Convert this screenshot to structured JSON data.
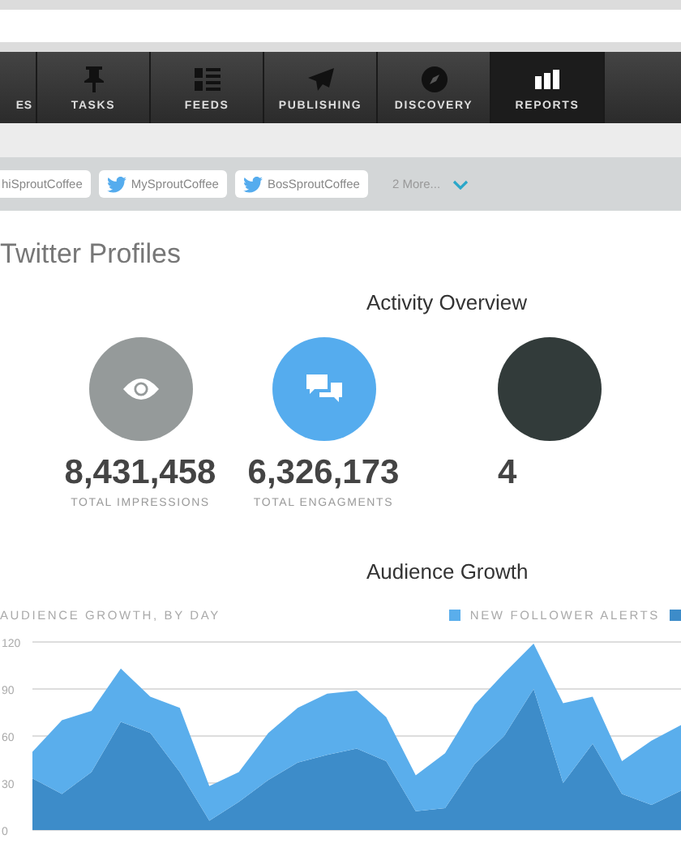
{
  "nav": {
    "tabs": [
      {
        "label": "ES",
        "selected": false
      },
      {
        "label": "TASKS",
        "selected": false
      },
      {
        "label": "FEEDS",
        "selected": false
      },
      {
        "label": "PUBLISHING",
        "selected": false
      },
      {
        "label": "DISCOVERY",
        "selected": false
      },
      {
        "label": "REPORTS",
        "selected": true
      }
    ]
  },
  "profiles": {
    "chips": [
      {
        "label": "hiSproutCoffee",
        "icon": false
      },
      {
        "label": "MySproutCoffee",
        "icon": true
      },
      {
        "label": "BosSproutCoffee",
        "icon": true
      }
    ],
    "more": "2 More..."
  },
  "page_title": "Twitter Profiles",
  "activity": {
    "title": "Activity Overview",
    "stats": [
      {
        "kind": "impressions",
        "color": "#959a9a",
        "value": "8,431,458",
        "label": "TOTAL IMPRESSIONS"
      },
      {
        "kind": "engagements",
        "color": "#55acee",
        "value": "6,326,173",
        "label": "TOTAL ENGAGMENTS"
      },
      {
        "kind": "partial",
        "color": "#323b3a",
        "value": "4"
      }
    ]
  },
  "audience": {
    "title": "Audience Growth",
    "chart_data": {
      "type": "area",
      "title": "AUDIENCE GROWTH, BY DAY",
      "stacked": true,
      "grid": true,
      "ylim": [
        0,
        120
      ],
      "yticks": [
        0,
        30,
        60,
        90,
        120
      ],
      "series": [
        {
          "color": "#3d8cc9",
          "values": [
            33,
            23,
            37,
            69,
            62,
            37,
            6,
            18,
            32,
            43,
            48,
            52,
            44,
            12,
            14,
            42,
            60,
            90,
            30,
            55,
            23,
            16,
            25
          ]
        },
        {
          "name": "NEW FOLLOWER ALERTS",
          "color": "#5aaeec",
          "values": [
            17,
            47,
            39,
            34,
            23,
            41,
            22,
            19,
            30,
            35,
            39,
            37,
            28,
            23,
            35,
            38,
            40,
            29,
            51,
            30,
            21,
            41,
            42
          ]
        }
      ]
    }
  }
}
